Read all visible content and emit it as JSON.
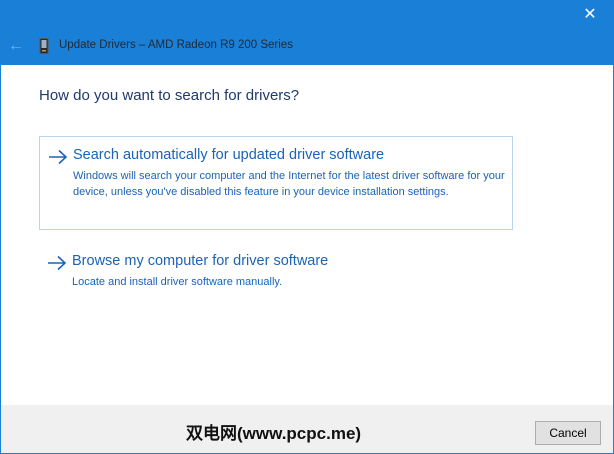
{
  "window": {
    "title": "Update Drivers – AMD Radeon R9 200 Series",
    "close_label": "✕",
    "back_label": "←",
    "accent_color": "#1a7fd6"
  },
  "main": {
    "question": "How do you want to search for drivers?",
    "options": [
      {
        "title": "Search automatically for updated driver software",
        "description": "Windows will search your computer and the Internet for the latest driver software for your device, unless you've disabled this feature in your device installation settings."
      },
      {
        "title": "Browse my computer for driver software",
        "description": "Locate and install driver software manually."
      }
    ]
  },
  "footer": {
    "watermark": "双电网(www.pcpc.me)",
    "cancel_label": "Cancel"
  },
  "icons": {
    "back": "back-arrow-icon",
    "device": "device-icon",
    "option_arrow": "right-arrow-icon",
    "close": "close-icon"
  }
}
